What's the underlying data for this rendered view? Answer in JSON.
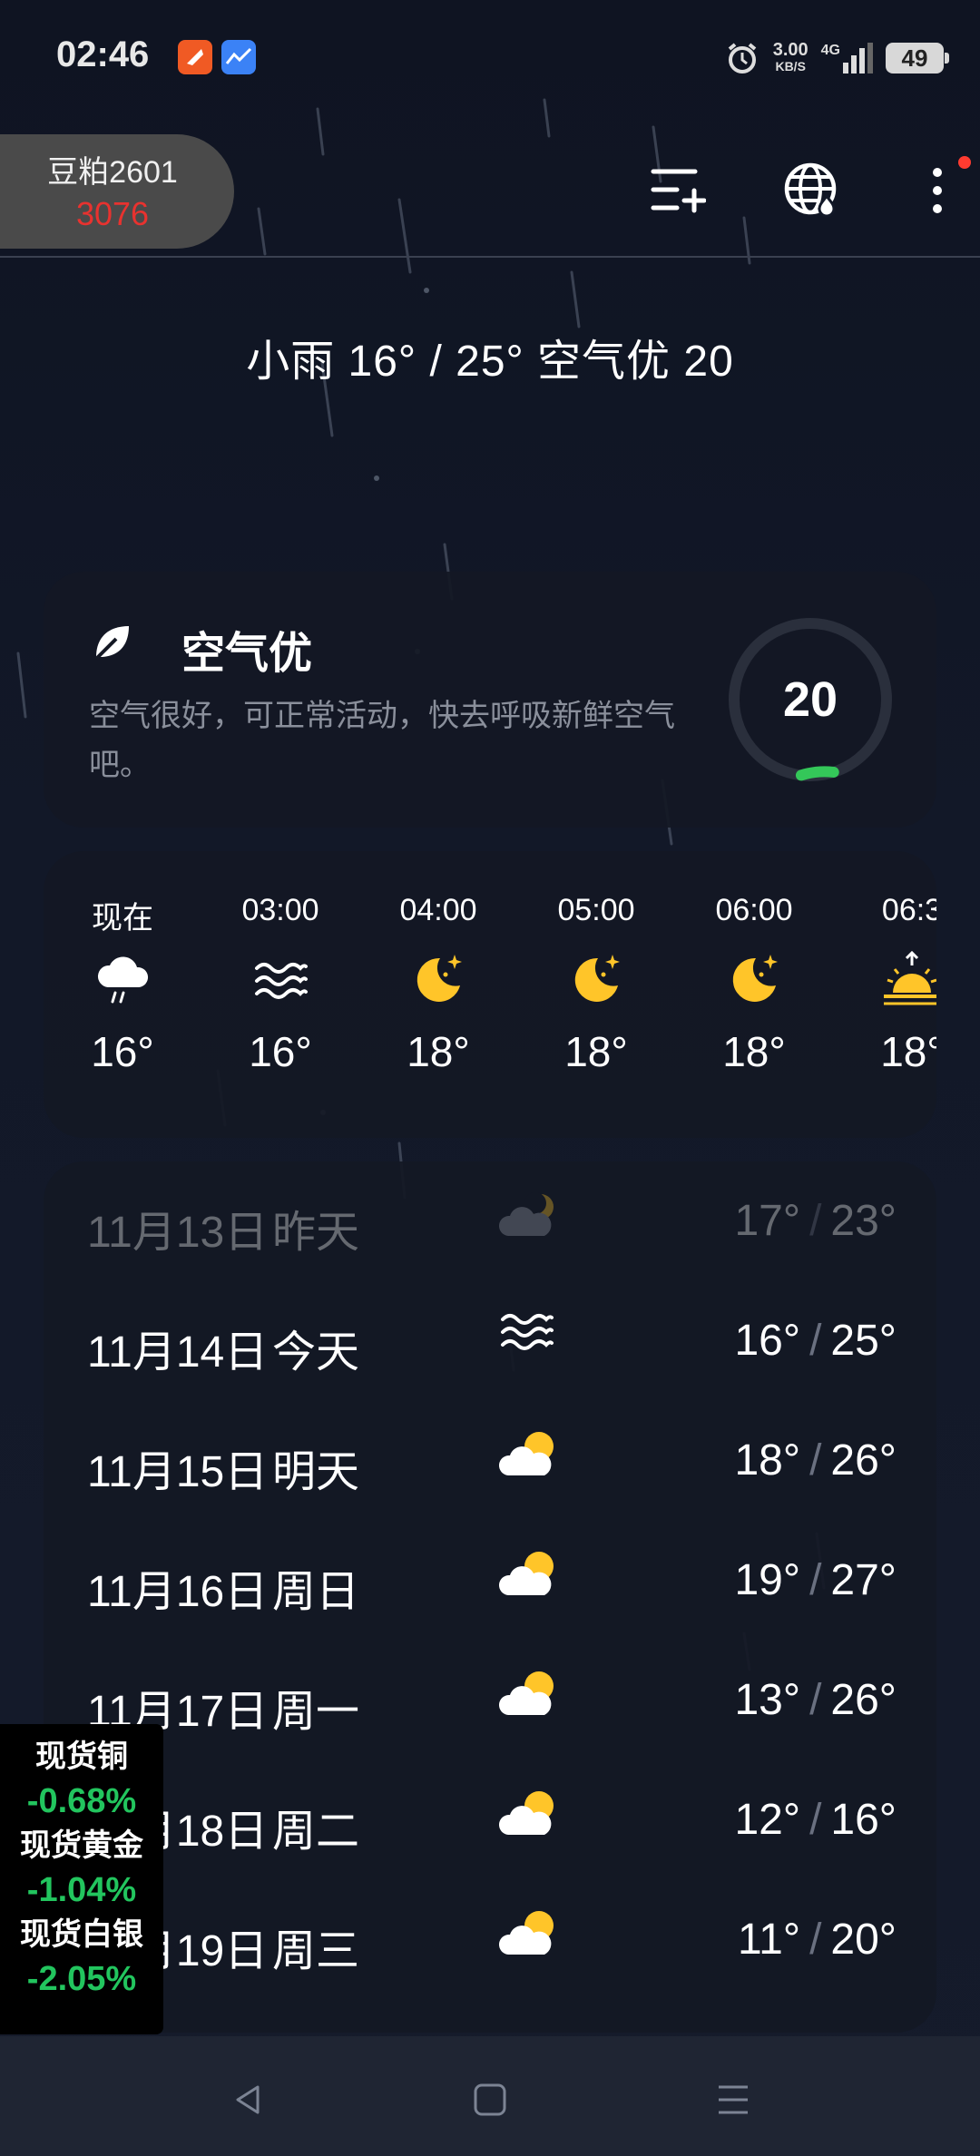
{
  "status_bar": {
    "time": "02:46",
    "net_speed": "3.00",
    "net_unit": "KB/S",
    "network": "4G",
    "battery": "49"
  },
  "ticker": {
    "name": "豆粕2601",
    "value": "3076"
  },
  "summary": "小雨  16° / 25°  空气优 20",
  "aqi": {
    "title": "空气优",
    "description": "空气很好，可正常活动，快去呼吸新鲜空气吧。",
    "value": "20",
    "level_fraction": 0.04,
    "color": "#34c759"
  },
  "hourly": [
    {
      "time": "现在",
      "icon": "rain-cloud-icon",
      "temp": "16°"
    },
    {
      "time": "03:00",
      "icon": "haze-icon",
      "temp": "16°"
    },
    {
      "time": "04:00",
      "icon": "moon-icon",
      "temp": "18°"
    },
    {
      "time": "05:00",
      "icon": "moon-icon",
      "temp": "18°"
    },
    {
      "time": "06:00",
      "icon": "moon-icon",
      "temp": "18°"
    },
    {
      "time": "06:3",
      "icon": "sunrise-icon",
      "temp": "18°"
    }
  ],
  "daily": [
    {
      "date": "11月13日",
      "day": "昨天",
      "icon": "cloudy-night-icon",
      "low": "17°",
      "high": "23°",
      "past": true
    },
    {
      "date": "11月14日",
      "day": "今天",
      "icon": "haze-icon",
      "low": "16°",
      "high": "25°"
    },
    {
      "date": "11月15日",
      "day": "明天",
      "icon": "partly-cloudy-icon",
      "low": "18°",
      "high": "26°"
    },
    {
      "date": "11月16日",
      "day": "周日",
      "icon": "partly-cloudy-icon",
      "low": "19°",
      "high": "27°"
    },
    {
      "date": "11月17日",
      "day": "周一",
      "icon": "partly-cloudy-icon",
      "low": "13°",
      "high": "26°"
    },
    {
      "date": "11月18日",
      "day": "周二",
      "icon": "partly-cloudy-icon",
      "low": "12°",
      "high": "16°"
    },
    {
      "date": "11月19日",
      "day": "周三",
      "icon": "partly-cloudy-icon",
      "low": "11°",
      "high": "20°"
    }
  ],
  "metals": [
    {
      "name": "现货铜",
      "change": "-0.68%"
    },
    {
      "name": "现货黄金",
      "change": "-1.04%"
    },
    {
      "name": "现货白银",
      "change": "-2.05%"
    }
  ],
  "colors": {
    "accent_sun": "#ffc529",
    "negative": "#22c55e",
    "price_red": "#e8322f"
  }
}
